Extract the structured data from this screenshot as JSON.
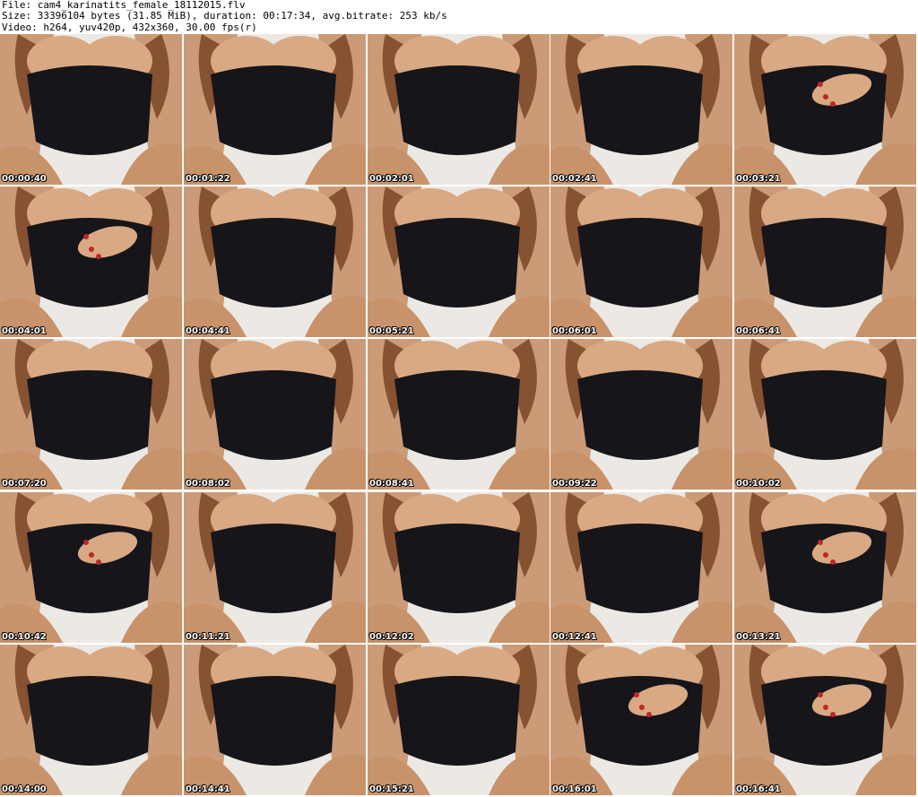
{
  "header": {
    "line1": "File: cam4_karinatits_female_18112015.flv",
    "line2": "Size: 33396104 bytes (31.85 MiB), duration: 00:17:34, avg.bitrate: 253 kb/s",
    "line3": "Video: h264, yuv420p, 432x360, 30.00 fps(r)"
  },
  "thumbnails": [
    {
      "timestamp": "00:00:40",
      "variant": "plain"
    },
    {
      "timestamp": "00:01:22",
      "variant": "plain"
    },
    {
      "timestamp": "00:02:01",
      "variant": "plain"
    },
    {
      "timestamp": "00:02:41",
      "variant": "plain"
    },
    {
      "timestamp": "00:03:21",
      "variant": "hand"
    },
    {
      "timestamp": "00:04:01",
      "variant": "hand"
    },
    {
      "timestamp": "00:04:41",
      "variant": "plain"
    },
    {
      "timestamp": "00:05:21",
      "variant": "plain"
    },
    {
      "timestamp": "00:06:01",
      "variant": "plain"
    },
    {
      "timestamp": "00:06:41",
      "variant": "plain"
    },
    {
      "timestamp": "00:07:20",
      "variant": "plain"
    },
    {
      "timestamp": "00:08:02",
      "variant": "plain"
    },
    {
      "timestamp": "00:08:41",
      "variant": "plain"
    },
    {
      "timestamp": "00:09:22",
      "variant": "plain"
    },
    {
      "timestamp": "00:10:02",
      "variant": "plain"
    },
    {
      "timestamp": "00:10:42",
      "variant": "hand"
    },
    {
      "timestamp": "00:11:21",
      "variant": "plain"
    },
    {
      "timestamp": "00:12:02",
      "variant": "plain"
    },
    {
      "timestamp": "00:12:41",
      "variant": "plain"
    },
    {
      "timestamp": "00:13:21",
      "variant": "hand"
    },
    {
      "timestamp": "00:14:00",
      "variant": "plain"
    },
    {
      "timestamp": "00:14:41",
      "variant": "plain"
    },
    {
      "timestamp": "00:15:21",
      "variant": "plain"
    },
    {
      "timestamp": "00:16:01",
      "variant": "hand"
    },
    {
      "timestamp": "00:16:41",
      "variant": "hand"
    }
  ],
  "colors": {
    "background": "#ffffff",
    "skin": "#c8926a",
    "skin_light": "#d9a983",
    "garment": "#15151a",
    "hair": "#7a4526",
    "bedding": "#ece9e4",
    "nail": "#c0262a"
  }
}
